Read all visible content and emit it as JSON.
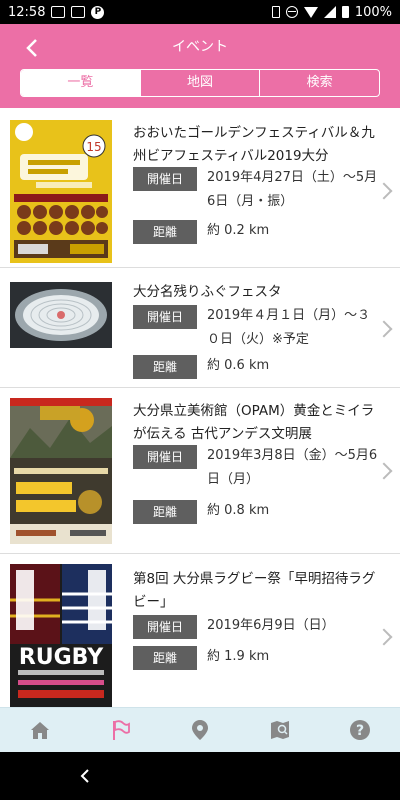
{
  "status_bar": {
    "time": "12:58",
    "battery": "100%",
    "notification_icons": [
      "image-icon",
      "square-icon",
      "parking-icon"
    ],
    "system_icons": [
      "vibrate-icon",
      "dnd-icon",
      "wifi-icon",
      "cell-signal-icon",
      "battery-icon"
    ]
  },
  "header": {
    "title": "イベント",
    "back_icon": "chevron-left-icon",
    "tabs": [
      {
        "label": "一覧",
        "active": true
      },
      {
        "label": "地図",
        "active": false
      },
      {
        "label": "検索",
        "active": false
      }
    ]
  },
  "events": [
    {
      "title": "おおいたゴールデンフェスティバル＆九州ビアフェスティバル2019大分",
      "date_label": "開催日",
      "date": "2019年4月27日（土）～5月6日（月・振）",
      "distance_label": "距離",
      "distance": "約 0.2 km",
      "image": "golden-festival-poster"
    },
    {
      "title": "大分名残りふぐフェスタ",
      "date_label": "開催日",
      "date": "2019年４月１日（月）～３０日（火）※予定",
      "distance_label": "距離",
      "distance": "約 0.6 km",
      "image": "fugu-sashimi-photo"
    },
    {
      "title": "大分県立美術館（OPAM）黄金とミイラが伝える 古代アンデス文明展",
      "date_label": "開催日",
      "date": "2019年3月8日（金）～5月6日（月）",
      "distance_label": "距離",
      "distance": "約 0.8 km",
      "image": "andes-exhibition-poster"
    },
    {
      "title": "第8回 大分県ラグビー祭「早明招待ラグビー」",
      "date_label": "開催日",
      "date": "2019年6月9日（日）",
      "distance_label": "距離",
      "distance": "約 1.9 km",
      "image": "rugby-festival-poster"
    }
  ],
  "bottom_nav": [
    {
      "icon": "home-icon",
      "active": false
    },
    {
      "icon": "flag-icon",
      "active": true
    },
    {
      "icon": "map-pin-icon",
      "active": false
    },
    {
      "icon": "map-search-icon",
      "active": false
    },
    {
      "icon": "help-icon",
      "active": false
    }
  ],
  "colors": {
    "header": "#ec6fa6",
    "tag": "#5f5f5f",
    "nav_bg": "#dfeff4",
    "nav_icon": "#888888",
    "nav_active": "#ec6fa6"
  }
}
